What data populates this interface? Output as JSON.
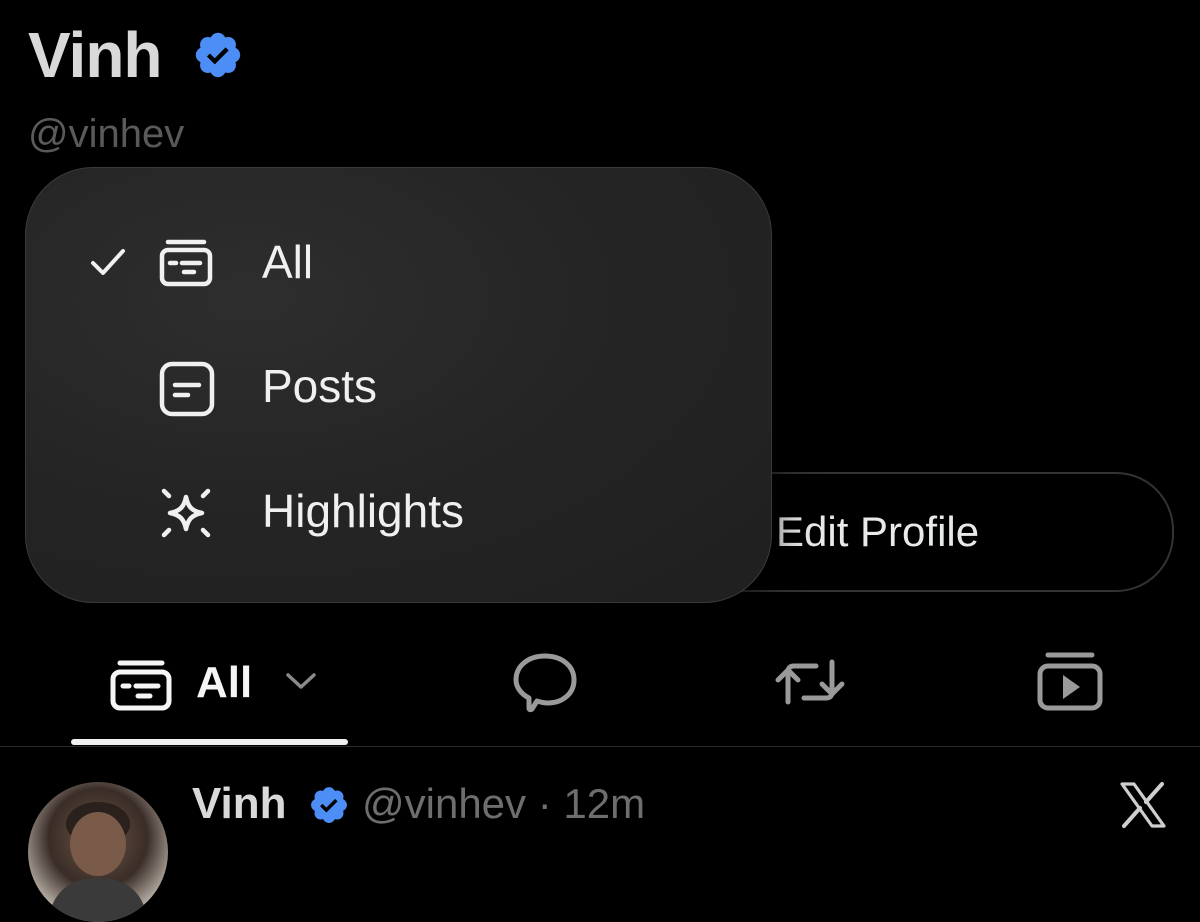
{
  "profile": {
    "name": "Vinh",
    "handle": "@vinhev"
  },
  "filter_menu": {
    "items": [
      {
        "label": "All",
        "icon": "all-feed-icon",
        "selected": true
      },
      {
        "label": "Posts",
        "icon": "posts-icon",
        "selected": false
      },
      {
        "label": "Highlights",
        "icon": "sparkle-icon",
        "selected": false
      }
    ]
  },
  "edit_profile_label": "Edit Profile",
  "tabs": {
    "active_label": "All",
    "icons": [
      "all-feed-icon",
      "reply-bubble-icon",
      "repost-icon",
      "media-icon"
    ]
  },
  "post": {
    "author_name": "Vinh",
    "meta": "@vinhev · 12m"
  },
  "colors": {
    "verified": "#4c8ef5",
    "background": "#000000",
    "menu_background": "#262626"
  }
}
